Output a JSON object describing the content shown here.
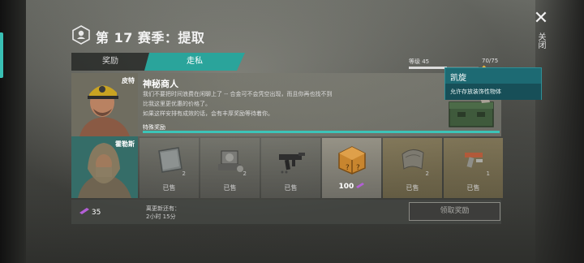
{
  "header": {
    "season_title": "第 17 赛季：提取",
    "close_label": "关闭"
  },
  "tabs": [
    {
      "label": "奖励",
      "active": false
    },
    {
      "label": "走私",
      "active": true
    }
  ],
  "progress": {
    "level_label": "等级 45",
    "level_fraction": 0.55,
    "xp_label": "70/75"
  },
  "merchant": {
    "npc_name": "皮特",
    "title": "神秘商人",
    "description_lines": [
      "我们不要把时间浪费在闲聊上了 -- 合金可不会凭空出现，而且你再也找不到",
      "比我这里更优惠的价格了。",
      "如果这样安排有成效的话，会有丰厚奖励等待着你。"
    ],
    "special_label": "特殊奖励"
  },
  "tooltip": {
    "title": "凯旋",
    "description": "允许存放装饰性物体"
  },
  "second_npc": {
    "name": "霍勒斯"
  },
  "items": [
    {
      "icon": "metal-plate-icon",
      "qty": "2",
      "status": "已售",
      "style": "normal"
    },
    {
      "icon": "engine-part-icon",
      "qty": "2",
      "status": "已售",
      "style": "normal"
    },
    {
      "icon": "smg-icon",
      "qty": "",
      "status": "已售",
      "style": "normal"
    },
    {
      "icon": "mystery-box-icon",
      "qty": "",
      "price": "100",
      "style": "highlight"
    },
    {
      "icon": "fabric-icon",
      "qty": "2",
      "status": "已售",
      "style": "gold"
    },
    {
      "icon": "pistol-parts-icon",
      "qty": "1",
      "status": "已售",
      "style": "gold"
    }
  ],
  "footer": {
    "currency_amount": "35",
    "refresh_line1": "离更新还有：",
    "refresh_line2": "2小时 15分",
    "claim_label": "领取奖励"
  },
  "colors": {
    "accent": "#2aa49b",
    "currency": "#b35fd6",
    "gold": "#f2b63c"
  }
}
